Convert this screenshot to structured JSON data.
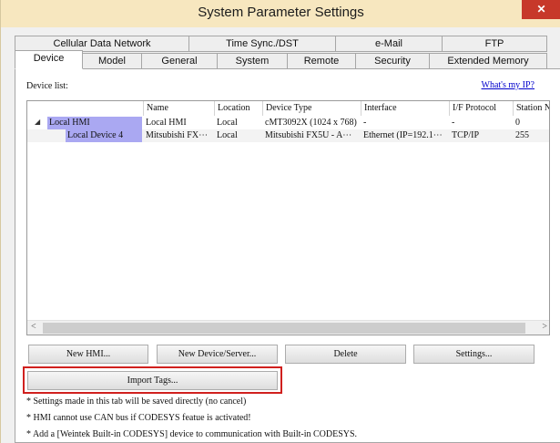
{
  "window": {
    "title": "System Parameter Settings",
    "close_glyph": "✕",
    "accent": "#f7e7bf",
    "close_color": "#c7382a"
  },
  "tabs": {
    "row1": [
      "Cellular Data Network",
      "Time Sync./DST",
      "e-Mail",
      "FTP"
    ],
    "row2": [
      "Device",
      "Model",
      "General",
      "System",
      "Remote",
      "Security",
      "Extended Memory"
    ],
    "active": "Device"
  },
  "device_list": {
    "label": "Device list:",
    "whats_my_ip": "What's my IP?",
    "columns": [
      "Name",
      "Location",
      "Device Type",
      "Interface",
      "I/F Protocol",
      "Station N"
    ],
    "rows": [
      {
        "tree": "Local HMI",
        "name": "Local HMI",
        "location": "Local",
        "device_type": "cMT3092X (1024 x 768)",
        "interface": "-",
        "protocol": "-",
        "station": "0"
      },
      {
        "tree": "Local Device 4",
        "name": "Mitsubishi FX⋯",
        "location": "Local",
        "device_type": "Mitsubishi FX5U - A⋯",
        "interface": "Ethernet (IP=192.1⋯",
        "protocol": "TCP/IP",
        "station": "255"
      }
    ],
    "selection_color": "#aaa8f2"
  },
  "buttons": {
    "new_hmi": "New HMI...",
    "new_device": "New Device/Server...",
    "delete": "Delete",
    "settings": "Settings...",
    "import_tags": "Import Tags...",
    "highlight_color": "#d0201e"
  },
  "notes": [
    "* Settings made in this tab will be saved directly (no cancel)",
    "* HMI cannot use CAN bus if CODESYS featue is activated!",
    "* Add a [Weintek Built-in CODESYS] device to communication with Built-in CODESYS."
  ]
}
